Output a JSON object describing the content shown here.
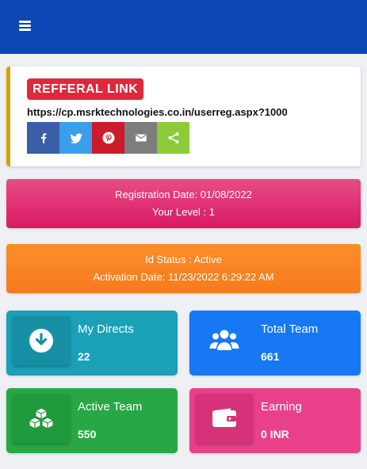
{
  "header": {
    "menu_icon": "hamburger-menu-icon"
  },
  "referral": {
    "badge": "REFFERAL LINK",
    "link": "https://cp.msrktechnologies.co.in/userreg.aspx?1000",
    "share_buttons": [
      {
        "icon": "facebook-icon",
        "color": "#3b5ea6"
      },
      {
        "icon": "twitter-icon",
        "color": "#3b9ee8"
      },
      {
        "icon": "pinterest-icon",
        "color": "#cc1b2a"
      },
      {
        "icon": "email-icon",
        "color": "#7d7d7d"
      },
      {
        "icon": "share-icon",
        "color": "#8ccc3a"
      }
    ]
  },
  "registration": {
    "date_text": "Registration Date: 01/08/2022",
    "level_text": "Your Level : 1"
  },
  "status": {
    "status_text": "Id Status : Active",
    "activation_text": "Activation Date: 11/23/2022 6:29:22 AM"
  },
  "tiles": {
    "directs": {
      "title": "My Directs",
      "value": "22",
      "icon": "download-icon"
    },
    "total_team": {
      "title": "Total Team",
      "value": "661",
      "icon": "users-icon"
    },
    "active_team": {
      "title": "Active Team",
      "value": "550",
      "icon": "cubes-icon"
    },
    "earning": {
      "title": "Earning",
      "value": "0 INR",
      "icon": "wallet-icon"
    }
  },
  "colors": {
    "header": "#0b47b5",
    "registration_card": "#dc2d6e",
    "status_card": "#f98425",
    "directs_tile": "#1aa1b8",
    "total_team_tile": "#1678f5",
    "active_team_tile": "#28a745",
    "earning_tile": "#e8418a"
  }
}
